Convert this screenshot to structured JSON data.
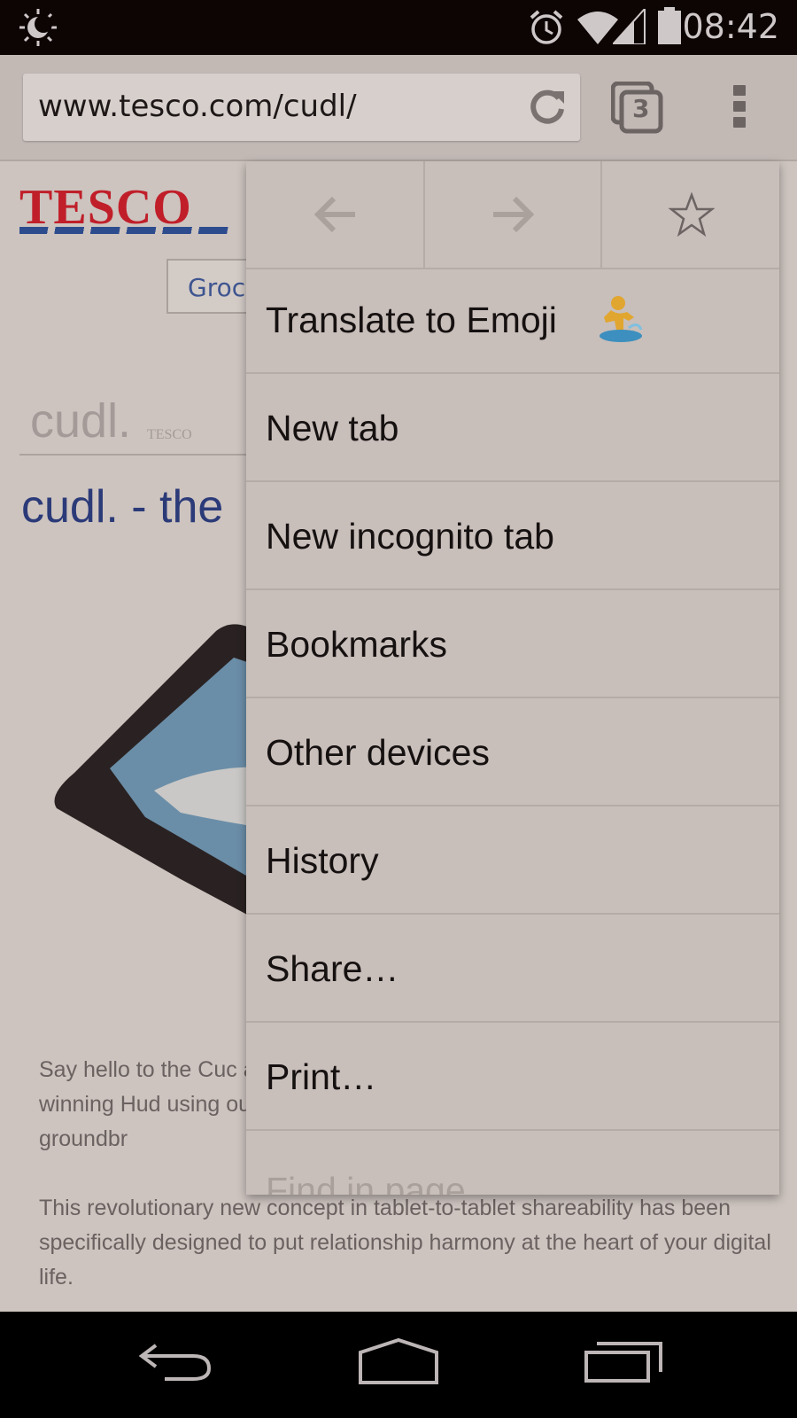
{
  "status_bar": {
    "time": "08:42",
    "icons": [
      "brightness-icon",
      "alarm-icon",
      "wifi-icon",
      "cell-signal-icon",
      "battery-icon"
    ]
  },
  "toolbar": {
    "url": "www.tesco.com/cudl/",
    "tab_count": "3",
    "reload_icon": "reload-icon",
    "menu_icon": "overflow-menu-icon"
  },
  "page": {
    "logo": "TESCO",
    "nav_button": "Groc",
    "cudl_small": "cudl.",
    "cudl_tiny": "TESCO",
    "heading": "cudl. - the",
    "para1": "Say hello to the Cuc award-winning Hud using our groundbr",
    "para2": "This revolutionary new concept in tablet-to-tablet shareability has been specifically designed to put relationship harmony at the heart of your digital life."
  },
  "menu": {
    "icon_row": [
      "back-arrow-icon",
      "forward-arrow-icon",
      "bookmark-star-icon"
    ],
    "items": [
      {
        "label": "Translate to Emoji",
        "icon": "surfer-emoji-icon"
      },
      {
        "label": "New tab"
      },
      {
        "label": "New incognito tab"
      },
      {
        "label": "Bookmarks"
      },
      {
        "label": "Other devices"
      },
      {
        "label": "History"
      },
      {
        "label": "Share…"
      },
      {
        "label": "Print…"
      },
      {
        "label": "Find in page"
      }
    ]
  },
  "nav_bar": {
    "buttons": [
      "back-nav-icon",
      "home-nav-icon",
      "recents-nav-icon"
    ]
  },
  "colors": {
    "tesco_red": "#c01f2a",
    "tesco_blue": "#2d4c8e",
    "menu_bg": "#c8beba",
    "status_bar_bg": "#0d0404"
  }
}
